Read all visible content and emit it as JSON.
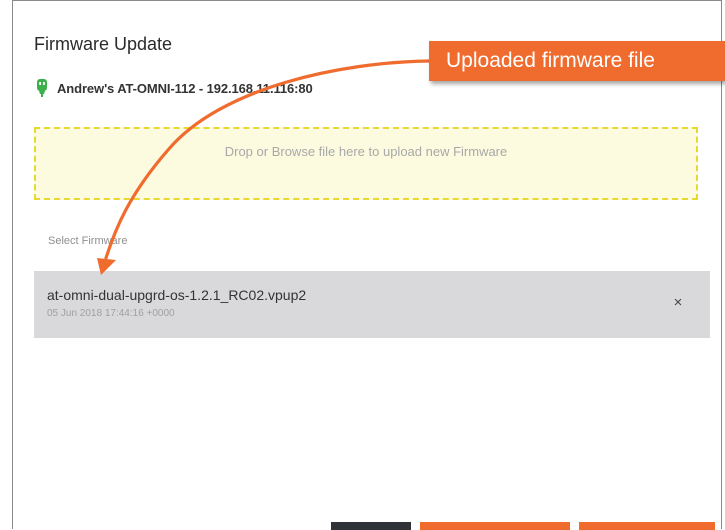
{
  "dialog": {
    "title": "Firmware Update",
    "device_name": "Andrew's AT-OMNI-112 - 192.168.11.116:80",
    "device_icon": "device-plug-icon",
    "device_icon_color": "#3db04b",
    "dropzone_text": "Drop or Browse file here to upload new Firmware",
    "select_label": "Select Firmware",
    "file": {
      "name": "at-omni-dual-upgrd-os-1.2.1_RC02.vpup2",
      "date": "05 Jun 2018 17:44:16 +0000",
      "remove_label": "×"
    },
    "colors": {
      "accent": "#f06b2e",
      "dropzone_border": "#e8d832",
      "dropzone_bg": "#fdfbdf",
      "file_row_bg": "#d9d9db"
    }
  },
  "callout": {
    "text": "Uploaded firmware file",
    "arrow_icon": "arrow-curve-icon"
  }
}
